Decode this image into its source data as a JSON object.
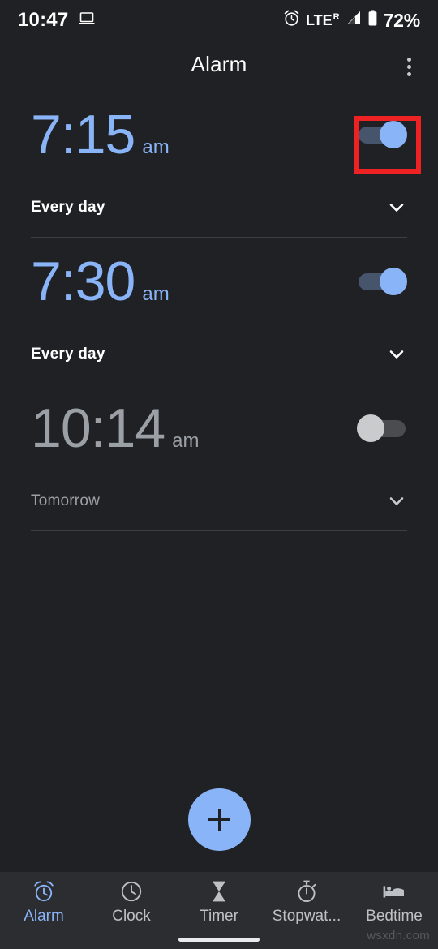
{
  "status_bar": {
    "time": "10:47",
    "cast_icon": "laptop-icon",
    "alarm_icon": "alarm-clock-icon",
    "network_label": "LTE",
    "network_roaming": "R",
    "signal_icon": "signal-bars-icon",
    "battery_icon": "battery-icon",
    "battery_level": "72%"
  },
  "app_bar": {
    "title": "Alarm",
    "overflow_menu": "more-options-icon"
  },
  "alarms": [
    {
      "time": "7:15",
      "meridiem": "am",
      "schedule": "Every day",
      "enabled": true,
      "highlighted": true
    },
    {
      "time": "7:30",
      "meridiem": "am",
      "schedule": "Every day",
      "enabled": true,
      "highlighted": false
    },
    {
      "time": "10:14",
      "meridiem": "am",
      "schedule": "Tomorrow",
      "enabled": false,
      "highlighted": false
    }
  ],
  "fab": {
    "label": "+",
    "icon": "plus-icon"
  },
  "bottom_nav": {
    "items": [
      {
        "label": "Alarm",
        "icon": "alarm-clock-icon",
        "active": true
      },
      {
        "label": "Clock",
        "icon": "clock-icon",
        "active": false
      },
      {
        "label": "Timer",
        "icon": "hourglass-icon",
        "active": false
      },
      {
        "label": "Stopwat...",
        "icon": "stopwatch-icon",
        "active": false
      },
      {
        "label": "Bedtime",
        "icon": "bed-icon",
        "active": false
      }
    ]
  },
  "watermark": "wsxdn.com",
  "colors": {
    "background": "#202124",
    "accent": "#8ab4f8",
    "nav_background": "#2b2d30",
    "disabled_text": "#9aa0a6",
    "highlight_box": "#ee2222"
  }
}
